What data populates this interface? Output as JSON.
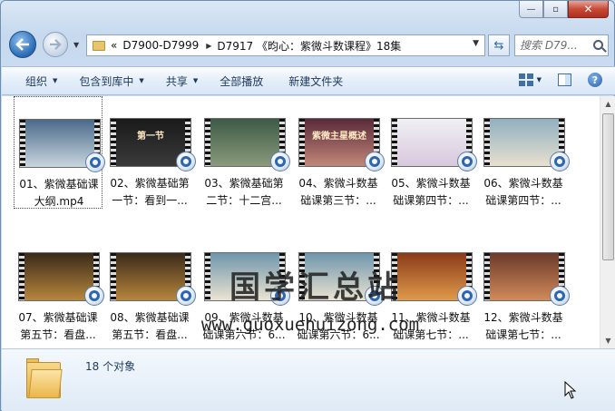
{
  "window": {
    "caption_buttons": {
      "min": "—",
      "max": "▫",
      "close": "✕"
    }
  },
  "address": {
    "prefix": "«",
    "segments": [
      "D7900-D7999",
      "D7917 《昀心：紫微斗数课程》18集"
    ]
  },
  "search": {
    "placeholder": "搜索 D79..."
  },
  "commands": [
    {
      "label": "组织",
      "has_caret": true
    },
    {
      "label": "包含到库中",
      "has_caret": true
    },
    {
      "label": "共享",
      "has_caret": true
    },
    {
      "label": "全部播放",
      "has_caret": false
    },
    {
      "label": "新建文件夹",
      "has_caret": false
    }
  ],
  "files": [
    {
      "line1": "01、紫微基础课",
      "line2": "大纲.mp4",
      "thumb_text": "",
      "thumb_color": "#4a6a8a",
      "thumb_color2": "#c9d6de",
      "selected": true
    },
    {
      "line1": "02、紫微基础第",
      "line2": "一节：看到一...",
      "thumb_text": "第一节",
      "thumb_color": "#1a1a1a",
      "thumb_color2": "#3a3a3a",
      "selected": false
    },
    {
      "line1": "03、紫微基础第",
      "line2": "二节：十二宫...",
      "thumb_text": "",
      "thumb_color": "#3d5a46",
      "thumb_color2": "#8a9a7c",
      "selected": false
    },
    {
      "line1": "04、紫微斗数基",
      "line2": "础课第三节：...",
      "thumb_text": "紫微主星概述",
      "thumb_color": "#5a2a3a",
      "thumb_color2": "#c2877a",
      "selected": false
    },
    {
      "line1": "05、紫微斗数基",
      "line2": "础课第四节：...",
      "thumb_text": "",
      "thumb_color": "#f0f0f4",
      "thumb_color2": "#d8c8dc",
      "selected": false
    },
    {
      "line1": "06、紫微斗数基",
      "line2": "础课第四节：...",
      "thumb_text": "",
      "thumb_color": "#8fb0c0",
      "thumb_color2": "#e8e0cf",
      "selected": false
    },
    {
      "line1": "07、紫微基础课",
      "line2": "第五节：看盘...",
      "thumb_text": "",
      "thumb_color": "#3a2a1a",
      "thumb_color2": "#b8863c",
      "selected": false
    },
    {
      "line1": "08、紫微基础课",
      "line2": "第五节：看盘...",
      "thumb_text": "",
      "thumb_color": "#3a2a1a",
      "thumb_color2": "#b8863c",
      "selected": false
    },
    {
      "line1": "09、紫微斗数基",
      "line2": "础课第六节：6...",
      "thumb_text": "",
      "thumb_color": "#6f96ac",
      "thumb_color2": "#ebe3d2",
      "selected": false
    },
    {
      "line1": "10、紫微斗数基",
      "line2": "础课第六节：6...",
      "thumb_text": "",
      "thumb_color": "#6f96ac",
      "thumb_color2": "#ebe3d2",
      "selected": false
    },
    {
      "line1": "11、紫微斗数基",
      "line2": "础课第七节：...",
      "thumb_text": "",
      "thumb_color": "#8a3a1a",
      "thumb_color2": "#e09a4a",
      "selected": false
    },
    {
      "line1": "12、紫微斗数基",
      "line2": "础课第七节：...",
      "thumb_text": "",
      "thumb_color": "#6a3a2a",
      "thumb_color2": "#d28a5a",
      "selected": false
    }
  ],
  "watermark": {
    "text": "国学汇总站",
    "url": "www.guoxuehuizong.com"
  },
  "details": {
    "count": "18 个对象"
  },
  "colors": {
    "accent": "#1e395b",
    "window_frame": "#6e8fb5",
    "close": "#c74a38"
  }
}
